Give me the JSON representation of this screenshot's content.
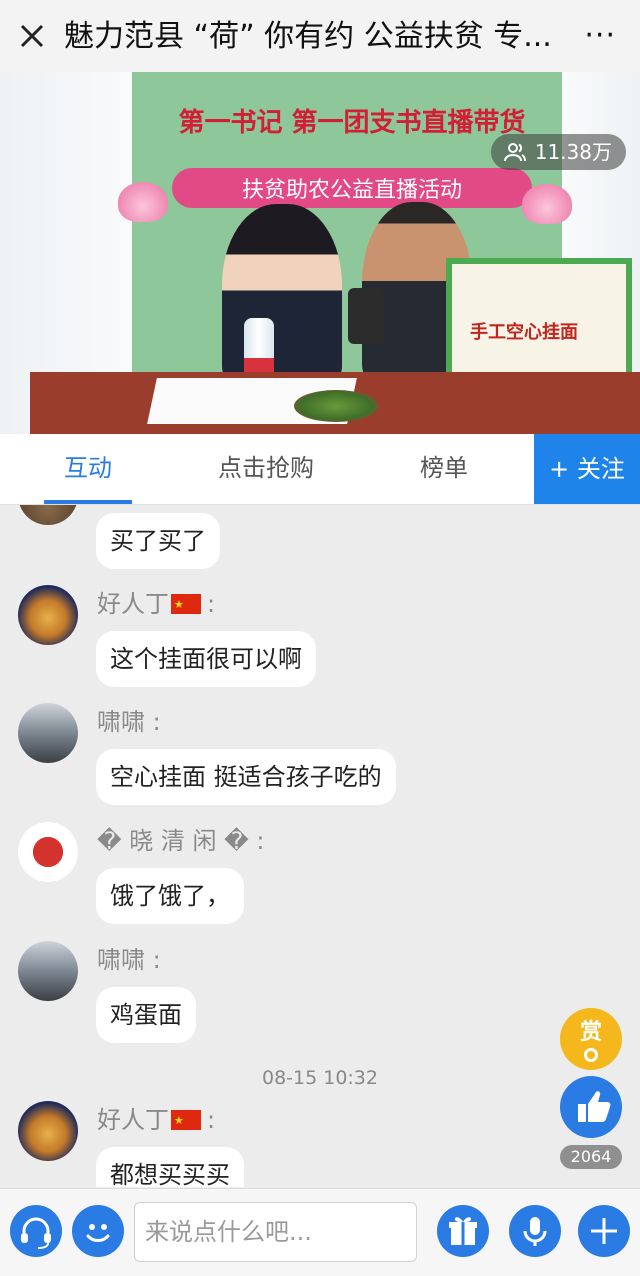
{
  "header": {
    "title": "魅力范县 “荷” 你有约 公益扶贫 专...",
    "more": "···"
  },
  "video": {
    "banner_line1": "第一书记 第一团支书直播带货",
    "banner_line2": "扶贫助农公益直播活动",
    "box_text": "手工空心挂面",
    "viewer_count": "11.38万"
  },
  "tabs": [
    {
      "label": "互动"
    },
    {
      "label": "点击抢购"
    },
    {
      "label": "榜单"
    }
  ],
  "follow_label": "+ 关注",
  "messages": [
    {
      "text": "买了买了"
    },
    {
      "user": "好人丁",
      "colon": ":",
      "text": "这个挂面很可以啊"
    },
    {
      "user": "啸啸 :",
      "text": "空心挂面 挺适合孩子吃的"
    },
    {
      "user": "� 晓 清 闲 � :",
      "text": "饿了饿了，"
    },
    {
      "user": "啸啸 :",
      "text": "鸡蛋面"
    },
    {
      "user": "好人丁",
      "colon": ":",
      "text": "都想买买买"
    }
  ],
  "timestamp": "08-15 10:32",
  "reward_label": "赏",
  "like_count": "2064",
  "input_placeholder": "来说点什么吧...",
  "colors": {
    "accent": "#2a7be4",
    "reward": "#f4b81c"
  }
}
